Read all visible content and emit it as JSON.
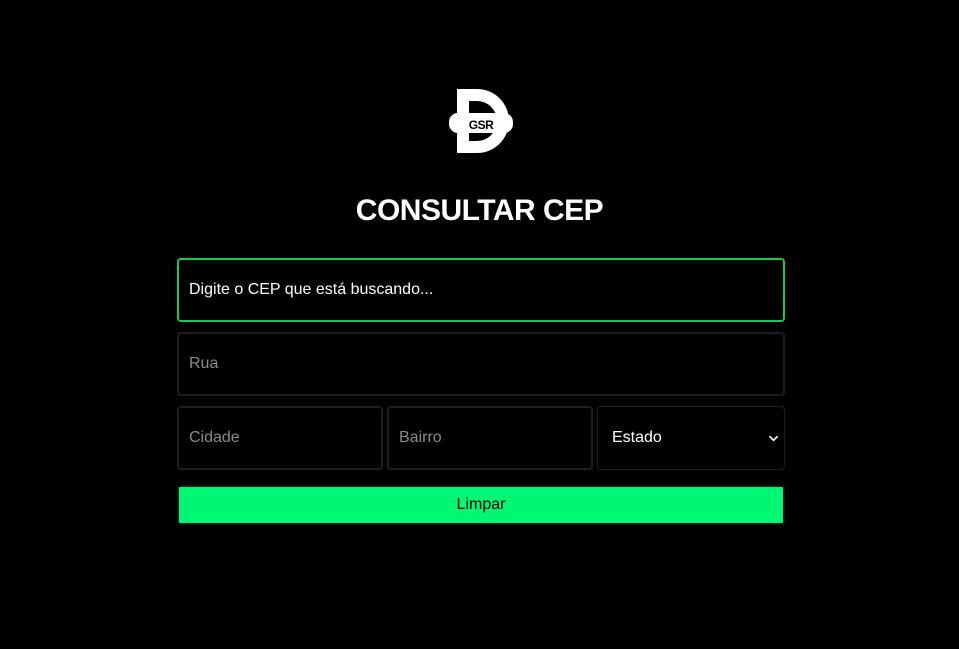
{
  "logo": {
    "letter_mark": "GSR",
    "code_glyph": "</>",
    "icon": "dev-d-logo-icon"
  },
  "title": "CONSULTAR CEP",
  "form": {
    "cep_placeholder": "Digite o CEP que está buscando...",
    "rua_placeholder": "Rua",
    "cidade_placeholder": "Cidade",
    "bairro_placeholder": "Bairro",
    "estado_selected": "Estado",
    "clear_label": "Limpar"
  },
  "colors": {
    "background": "#000000",
    "accent": "#00f773",
    "focus_border": "#16c85a",
    "field_border": "#1e1e1e"
  }
}
